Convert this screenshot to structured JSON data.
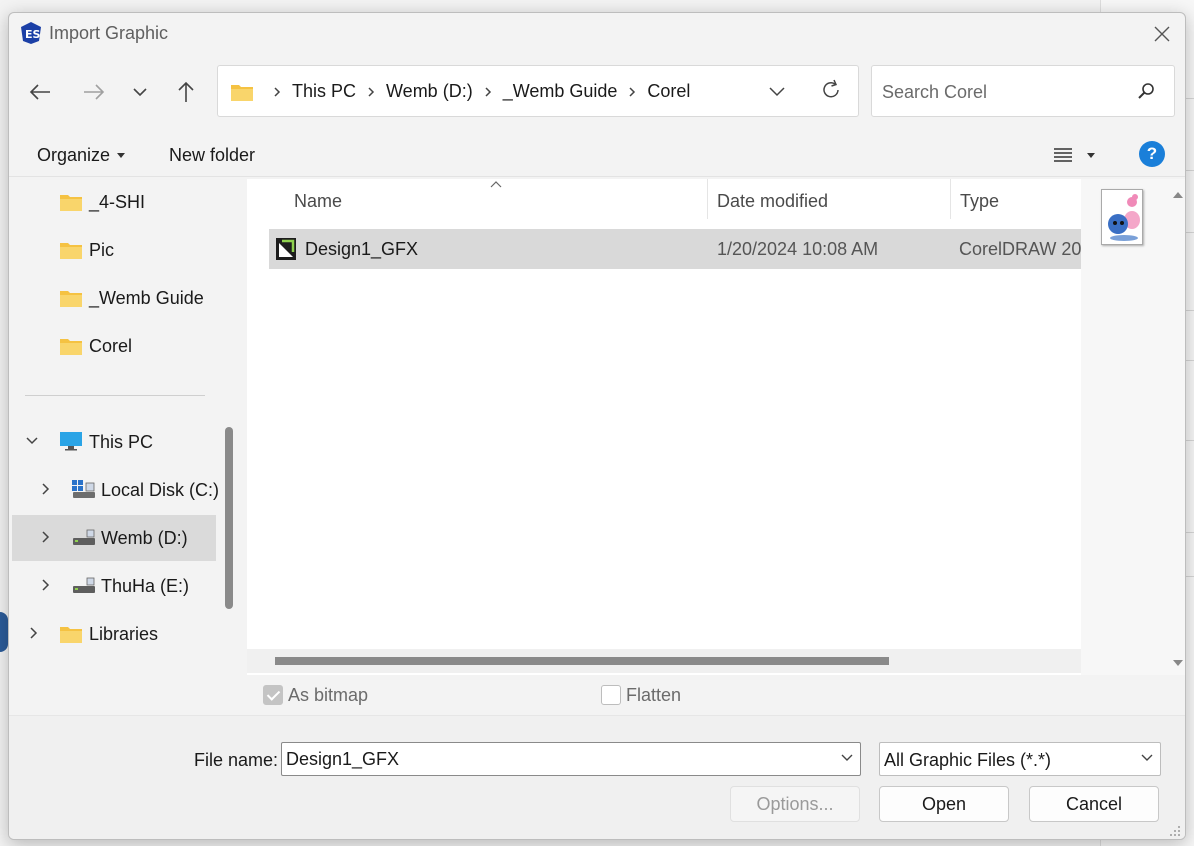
{
  "window": {
    "title": "Import Graphic",
    "close_icon": "close-icon"
  },
  "address": {
    "crumbs": [
      "This PC",
      "Wemb (D:)",
      "_Wemb Guide",
      "Corel"
    ]
  },
  "search": {
    "placeholder": "Search Corel"
  },
  "toolbar": {
    "organize": "Organize",
    "new_folder": "New folder",
    "help": "?"
  },
  "sidebar": {
    "items": [
      {
        "label": "_4-SHI"
      },
      {
        "label": "Pic"
      },
      {
        "label": "_Wemb Guide"
      },
      {
        "label": "Corel"
      },
      {
        "label": "This PC"
      },
      {
        "label": "Local Disk (C:)"
      },
      {
        "label": "Wemb (D:)"
      },
      {
        "label": "ThuHa (E:)"
      },
      {
        "label": "Libraries"
      }
    ]
  },
  "columns": {
    "name": "Name",
    "date": "Date modified",
    "type": "Type"
  },
  "files": [
    {
      "name": "Design1_GFX",
      "date": "1/20/2024 10:08 AM",
      "type": "CorelDRAW 20"
    }
  ],
  "options": {
    "as_bitmap": "As bitmap",
    "flatten": "Flatten"
  },
  "footer": {
    "file_name_label": "File name:",
    "file_name_value": "Design1_GFX",
    "file_type": "All Graphic Files (*.*)",
    "options_btn": "Options...",
    "open_btn": "Open",
    "cancel_btn": "Cancel"
  },
  "colors": {
    "accent": "#1a7fd9",
    "folder": "#f5c242",
    "selection": "#d9d9d9"
  }
}
